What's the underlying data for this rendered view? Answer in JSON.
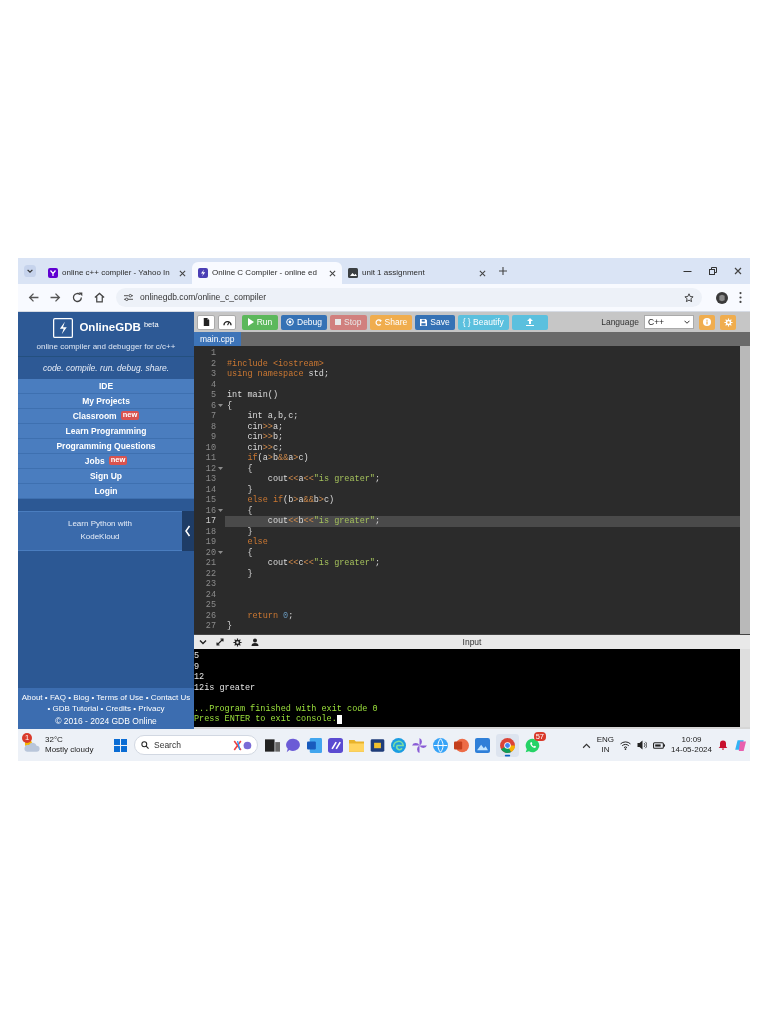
{
  "browser": {
    "tabs": [
      {
        "title": "online c++ compiler - Yahoo In",
        "selected": false
      },
      {
        "title": "Online C Compiler - online ed",
        "selected": true
      },
      {
        "title": "unit 1 assignment",
        "selected": false
      }
    ],
    "url": "onlinegdb.com/online_c_compiler"
  },
  "sidebar": {
    "brand": "OnlineGDB $^{beta}$",
    "subtitle": "online compiler and debugger for c/c++",
    "tagline": "code. compile. run. debug. share.",
    "menu": [
      {
        "label": "IDE"
      },
      {
        "label": "My Projects"
      },
      {
        "label": "Classroom",
        "badge": "new"
      },
      {
        "label": "Learn Programming"
      },
      {
        "label": "Programming Questions"
      },
      {
        "label": "Jobs",
        "badge": "new"
      },
      {
        "label": "Sign Up"
      },
      {
        "label": "Login"
      }
    ],
    "promo": "Learn Python with KodeKloud",
    "footer": {
      "links": [
        {
          "label": "About",
          "separator": "•"
        },
        {
          "label": "FAQ",
          "separator": "•"
        },
        {
          "label": "Blog",
          "separator": "•"
        },
        {
          "label": "Terms of Use",
          "separator": "•"
        },
        {
          "label": "Contact Us",
          "separator": "•"
        },
        {
          "label": "GDB Tutorial",
          "separator": "•"
        },
        {
          "label": "Credits",
          "separator": "•"
        },
        {
          "label": "Privacy"
        }
      ],
      "copyright": "© 2016 - 2024 GDB Online"
    }
  },
  "editor": {
    "buttons": [
      {
        "label": "Run",
        "kind": "success",
        "disabled": false
      },
      {
        "label": "Debug",
        "kind": "primary",
        "disabled": false
      },
      {
        "label": "Stop",
        "kind": "danger",
        "disabled": true
      },
      {
        "label": "Share",
        "kind": "warning",
        "disabled": false
      },
      {
        "label": "Save",
        "kind": "primary",
        "disabled": false
      },
      {
        "label": "{ } Beautify",
        "kind": "info",
        "disabled": false
      }
    ],
    "language": {
      "label": "Language",
      "value": "C++"
    },
    "file_tab": {
      "label": "main.cpp",
      "selected": true
    },
    "lines": [
      {
        "number": "1",
        "foldable": false,
        "current": false
      },
      {
        "number": "2",
        "foldable": false,
        "current": false,
        "tokens": [
          {
            "kind": "directive",
            "text": "#include <iostream>"
          }
        ]
      },
      {
        "number": "3",
        "foldable": false,
        "current": false,
        "tokens": [
          {
            "kind": "keyword",
            "text": "using namespace"
          },
          {
            "kind": "plain",
            "text": " std;"
          }
        ]
      },
      {
        "number": "4",
        "foldable": false,
        "current": false
      },
      {
        "number": "5",
        "foldable": false,
        "current": false,
        "tokens": [
          {
            "kind": "plain",
            "text": "int main()"
          }
        ]
      },
      {
        "number": "6",
        "foldable": true,
        "current": false,
        "tokens": [
          {
            "kind": "plain",
            "text": "{"
          }
        ]
      },
      {
        "number": "7",
        "foldable": false,
        "current": false,
        "tokens": [
          {
            "kind": "plain",
            "text": "    int a,b,c;"
          }
        ]
      },
      {
        "number": "8",
        "foldable": false,
        "current": false,
        "tokens": [
          {
            "kind": "plain",
            "text": "    cin"
          },
          {
            "kind": "operator",
            "text": ">>"
          },
          {
            "kind": "plain",
            "text": "a;"
          }
        ]
      },
      {
        "number": "9",
        "foldable": false,
        "current": false,
        "tokens": [
          {
            "kind": "plain",
            "text": "    cin"
          },
          {
            "kind": "operator",
            "text": ">>"
          },
          {
            "kind": "plain",
            "text": "b;"
          }
        ]
      },
      {
        "number": "10",
        "foldable": false,
        "current": false,
        "tokens": [
          {
            "kind": "plain",
            "text": "    cin"
          },
          {
            "kind": "operator",
            "text": ">>"
          },
          {
            "kind": "plain",
            "text": "c;"
          }
        ]
      },
      {
        "number": "11",
        "foldable": false,
        "current": false,
        "tokens": [
          {
            "kind": "keyword",
            "text": "    if"
          },
          {
            "kind": "plain",
            "text": "(a"
          },
          {
            "kind": "operator",
            "text": ">"
          },
          {
            "kind": "plain",
            "text": "b"
          },
          {
            "kind": "operator",
            "text": "&&"
          },
          {
            "kind": "plain",
            "text": "a"
          },
          {
            "kind": "operator",
            "text": ">"
          },
          {
            "kind": "plain",
            "text": "c)"
          }
        ]
      },
      {
        "number": "12",
        "foldable": true,
        "current": false,
        "tokens": [
          {
            "kind": "plain",
            "text": "    {"
          }
        ]
      },
      {
        "number": "13",
        "foldable": false,
        "current": false,
        "tokens": [
          {
            "kind": "plain",
            "text": "        cout"
          },
          {
            "kind": "operator",
            "text": "<<"
          },
          {
            "kind": "plain",
            "text": "a"
          },
          {
            "kind": "operator",
            "text": "<<"
          },
          {
            "kind": "string",
            "text": "\"is greater\""
          },
          {
            "kind": "plain",
            "text": ";"
          }
        ]
      },
      {
        "number": "14",
        "foldable": false,
        "current": false,
        "tokens": [
          {
            "kind": "plain",
            "text": "    }"
          }
        ]
      },
      {
        "number": "15",
        "foldable": false,
        "current": false,
        "tokens": [
          {
            "kind": "keyword",
            "text": "    else if"
          },
          {
            "kind": "plain",
            "text": "(b"
          },
          {
            "kind": "operator",
            "text": ">"
          },
          {
            "kind": "plain",
            "text": "a"
          },
          {
            "kind": "operator",
            "text": "&&"
          },
          {
            "kind": "plain",
            "text": "b"
          },
          {
            "kind": "operator",
            "text": ">"
          },
          {
            "kind": "plain",
            "text": "c)"
          }
        ]
      },
      {
        "number": "16",
        "foldable": true,
        "current": false,
        "tokens": [
          {
            "kind": "plain",
            "text": "    {"
          }
        ]
      },
      {
        "number": "17",
        "foldable": false,
        "current": true,
        "tokens": [
          {
            "kind": "plain",
            "text": "        cout"
          },
          {
            "kind": "operator",
            "text": "<<"
          },
          {
            "kind": "plain",
            "text": "b"
          },
          {
            "kind": "operator",
            "text": "<<"
          },
          {
            "kind": "string",
            "text": "\"is greater\""
          },
          {
            "kind": "plain",
            "text": ";"
          }
        ]
      },
      {
        "number": "18",
        "foldable": false,
        "current": false,
        "tokens": [
          {
            "kind": "plain",
            "text": "    }"
          }
        ]
      },
      {
        "number": "19",
        "foldable": false,
        "current": false,
        "tokens": [
          {
            "kind": "keyword",
            "text": "    else"
          }
        ]
      },
      {
        "number": "20",
        "foldable": true,
        "current": false,
        "tokens": [
          {
            "kind": "plain",
            "text": "    {"
          }
        ]
      },
      {
        "number": "21",
        "foldable": false,
        "current": false,
        "tokens": [
          {
            "kind": "plain",
            "text": "        cout"
          },
          {
            "kind": "operator",
            "text": "<<"
          },
          {
            "kind": "plain",
            "text": "c"
          },
          {
            "kind": "operator",
            "text": "<<"
          },
          {
            "kind": "string",
            "text": "\"is greater\""
          },
          {
            "kind": "plain",
            "text": ";"
          }
        ]
      },
      {
        "number": "22",
        "foldable": false,
        "current": false,
        "tokens": [
          {
            "kind": "plain",
            "text": "    }"
          }
        ]
      },
      {
        "number": "23",
        "foldable": false,
        "current": false
      },
      {
        "number": "24",
        "foldable": false,
        "current": false
      },
      {
        "number": "25",
        "foldable": false,
        "current": false
      },
      {
        "number": "26",
        "foldable": false,
        "current": false,
        "tokens": [
          {
            "kind": "keyword",
            "text": "    return "
          },
          {
            "kind": "number",
            "text": "0"
          },
          {
            "kind": "plain",
            "text": ";"
          }
        ]
      },
      {
        "number": "27",
        "foldable": false,
        "current": false,
        "tokens": [
          {
            "kind": "plain",
            "text": "}"
          }
        ]
      }
    ]
  },
  "console": {
    "title": "Input",
    "lines": [
      {
        "text": "5",
        "kind": "output",
        "cursor": false
      },
      {
        "text": "9",
        "kind": "output",
        "cursor": false
      },
      {
        "text": "12",
        "kind": "output",
        "cursor": false
      },
      {
        "text": "12is greater",
        "kind": "output",
        "cursor": false
      },
      {
        "kind": "blank",
        "cursor": false
      },
      {
        "text": "...Program finished with exit code 0",
        "kind": "status",
        "cursor": false
      },
      {
        "text": "Press ENTER to exit console.",
        "kind": "status",
        "cursor": true
      }
    ]
  },
  "taskbar": {
    "weather": {
      "badge": "1",
      "temperature": "32°C",
      "condition": "Mostly cloudy"
    },
    "search": {
      "placeholder": "Search"
    },
    "apps": [
      {
        "selected": false
      },
      {
        "selected": false
      },
      {
        "selected": false
      },
      {
        "selected": false
      },
      {
        "selected": false
      },
      {
        "selected": false
      },
      {
        "selected": false
      },
      {
        "selected": false
      },
      {
        "selected": false
      },
      {
        "selected": false
      },
      {
        "selected": false
      },
      {
        "selected": true
      },
      {
        "selected": false,
        "badge": "57"
      }
    ],
    "tray": {
      "language": "ENG",
      "region": "IN",
      "time": "10:09",
      "date": "14-05-2024"
    }
  }
}
